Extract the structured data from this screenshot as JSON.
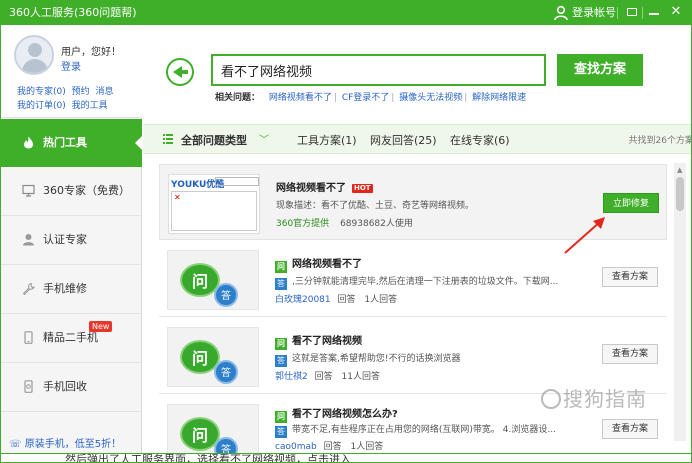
{
  "window": {
    "title": "360人工服务(360问题帮)",
    "login_label": "登录帐号"
  },
  "profile": {
    "greeting": "用户，您好！",
    "login_link": "登录",
    "links_row1": [
      "我的专家(0)",
      "预约",
      "消息"
    ],
    "links_row2": [
      "我的订单(0)",
      "我的工具"
    ]
  },
  "sidebar": {
    "items": [
      {
        "label": "热门工具",
        "icon": "fire-icon",
        "active": true
      },
      {
        "label": "360专家（免费）",
        "icon": "monitor-icon",
        "active": false
      },
      {
        "label": "认证专家",
        "icon": "person-icon",
        "active": false
      },
      {
        "label": "手机维修",
        "icon": "wrench-icon",
        "active": false
      },
      {
        "label": "精品二手机",
        "icon": "phone-icon",
        "active": false,
        "badge": "New"
      },
      {
        "label": "手机回收",
        "icon": "recycle-phone-icon",
        "active": false
      }
    ],
    "promo": "原装手机，低至5折！"
  },
  "search": {
    "value": "看不了网络视频",
    "button": "查找方案",
    "related_label": "相关问题：",
    "related": [
      "网络视频看不了",
      "CF登录不了",
      "摄像头无法视频",
      "解除网络限速"
    ]
  },
  "filter": {
    "all_types": "全部问题类型",
    "tabs": [
      "工具方案(1)",
      "网友回答(25)",
      "在线专家(6)"
    ],
    "total": "共找到26个方案"
  },
  "results": [
    {
      "title": "网络视频看不了",
      "badge": "HOT",
      "thumb_brand": "YOUKU优酷",
      "desc": "现象描述：看不了优酷、土豆、奇艺等网络视频。",
      "source": "360官方提供",
      "users": "68938682人使用",
      "button": "立即修复"
    },
    {
      "title": "网络视频看不了",
      "q_icon": "问",
      "a_icon": "答",
      "answer": ",三分钟就能清理完毕,然后在清理一下注册表的垃圾文件。下载网...",
      "author": "白玫瑰20081",
      "answers": "回答",
      "count": "1人回答",
      "button": "查看方案"
    },
    {
      "title": "看不了网络视频",
      "q_icon": "问",
      "a_icon": "答",
      "answer": "这就是答案,希望帮助您!不行的话换浏览器",
      "author": "郭仕祺2",
      "answers": "回答",
      "count": "11人回答",
      "button": "查看方案"
    },
    {
      "title": "看不了网络视频怎么办?",
      "q_icon": "问",
      "a_icon": "答",
      "answer": "带宽不足,有些程序正在占用您的网络(互联网)带宽。 4.浏览器设...",
      "author": "cao0mab",
      "answers": "回答",
      "count": "1人回答",
      "button": "查看方案"
    }
  ],
  "watermark": "搜狗指南",
  "bottom_text": "然后弹出了人工服务界面，选择看不了网络视频，点击进入"
}
